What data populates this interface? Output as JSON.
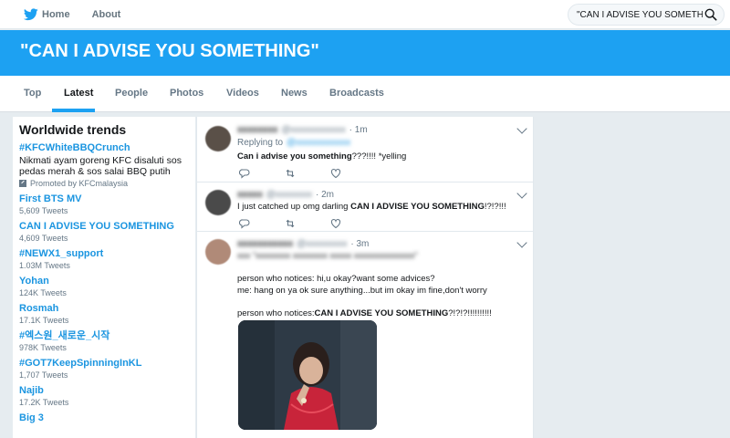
{
  "nav": {
    "home_label": "Home",
    "about_label": "About",
    "search_value": "\"CAN I ADVISE YOU SOMETHING"
  },
  "banner": {
    "title": "\"CAN I ADVISE YOU SOMETHING\""
  },
  "tabs": [
    {
      "label": "Top"
    },
    {
      "label": "Latest",
      "active": true
    },
    {
      "label": "People"
    },
    {
      "label": "Photos"
    },
    {
      "label": "Videos"
    },
    {
      "label": "News"
    },
    {
      "label": "Broadcasts"
    }
  ],
  "trends": {
    "title": "Worldwide trends",
    "promoted": {
      "name": "#KFCWhiteBBQCrunch",
      "desc": "Nikmati ayam goreng KFC disaluti sos pedas merah & sos salai BBQ putih",
      "promo": "Promoted by KFCmalaysia"
    },
    "items": [
      {
        "name": "First BTS MV",
        "count": "5,609 Tweets"
      },
      {
        "name": "CAN I ADVISE YOU SOMETHING",
        "count": "4,609 Tweets"
      },
      {
        "name": "#NEWX1_support",
        "count": "1.03M Tweets"
      },
      {
        "name": "Yohan",
        "count": "124K Tweets"
      },
      {
        "name": "Rosmah",
        "count": "17.1K Tweets"
      },
      {
        "name": "#엑스원_새로운_시작",
        "count": "978K Tweets"
      },
      {
        "name": "#GOT7KeepSpinningInKL",
        "count": "1,707 Tweets"
      },
      {
        "name": "Najib",
        "count": "17.2K Tweets"
      },
      {
        "name": "Big 3",
        "count": ""
      }
    ]
  },
  "tweets": [
    {
      "user": "xxxxxxxx",
      "handle": "@xxxxxxxxxxxx",
      "time": "· 1m",
      "reply_prefix": "Replying to",
      "reply_to": "@xxxxxxxxxxxx",
      "text_bold": "Can i advise you something",
      "text_rest": "???!!!! *yelling"
    },
    {
      "user": "xxxxx",
      "handle": "@xxxxxxxx",
      "time": "· 2m",
      "text_pre": "I just catched up omg darling ",
      "text_bold": "CAN I ADVISE YOU SOMETHING",
      "text_rest": "!?!?!!!"
    },
    {
      "user": "xxxxxxxxxxx",
      "handle": "@xxxxxxxxx",
      "time": "· 3m",
      "hidden_line": "xxx \"xxxxxxxx xxxxxxxx xxxxx xxxxxxxxxxxxxx\"",
      "line1": "person who notices: hi,u okay?want some advices?",
      "line2": "me: hang on ya ok sure anything...but im okay im fine,don't worry",
      "line3_pre": "person who notices:",
      "line3_bold": "CAN I ADVISE YOU SOMETHING",
      "line3_rest": "?!?!?!!!!!!!!!!"
    }
  ],
  "colors": {
    "accent": "#1da1f2",
    "link": "#1b95e0",
    "background": "#e6ecf0"
  }
}
